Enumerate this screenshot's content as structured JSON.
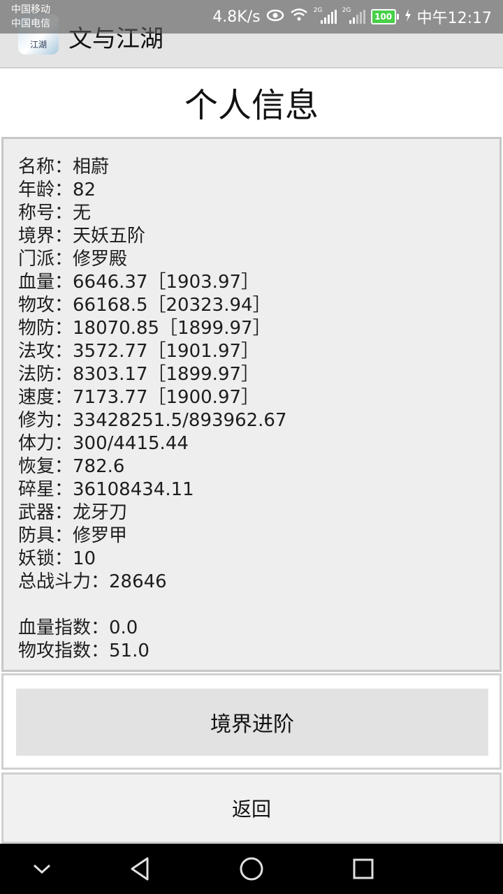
{
  "status_bar": {
    "carrier_1": "中国移动",
    "carrier_2": "中国电信",
    "network_speed": "4.8K/s",
    "battery_level": "100",
    "time": "中午12:17",
    "signal_1_label": "2G",
    "signal_2_label": "2G"
  },
  "app": {
    "title": "文与江湖",
    "logo_text": "江湖"
  },
  "page": {
    "title": "个人信息"
  },
  "info": [
    "名称：相蔚",
    "年龄：82",
    "称号：无",
    "境界：天妖五阶",
    "门派：修罗殿",
    "血量：6646.37［1903.97］",
    "物攻：66168.5［20323.94］",
    "物防：18070.85［1899.97］",
    "法攻：3572.77［1901.97］",
    "法防：8303.17［1899.97］",
    "速度：7173.77［1900.97］",
    "修为：33428251.5/893962.67",
    "体力：300/4415.44",
    "恢复：782.6",
    "碎星：36108434.11",
    "武器：龙牙刀",
    "防具：修罗甲",
    "妖锁：10",
    "总战斗力：28646",
    "",
    "血量指数：0.0",
    "物攻指数：51.0"
  ],
  "buttons": {
    "advance": "境界进阶",
    "back": "返回"
  },
  "nav": {
    "icons": [
      "chevron-down-icon",
      "back-triangle-icon",
      "home-circle-icon",
      "recents-square-icon"
    ]
  },
  "colors": {
    "battery": "#48d048",
    "panel_bg": "#eeeeee",
    "button_bg": "#e2e2e2"
  }
}
